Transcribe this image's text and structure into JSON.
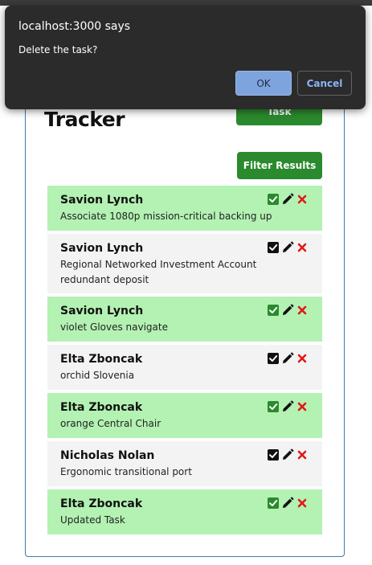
{
  "page": {
    "title": "Tracker",
    "add_button_label": "Task",
    "filter_button_label": "Filter Results"
  },
  "tasks": [
    {
      "name": "Savion Lynch",
      "description": "Associate 1080p mission-critical backing up",
      "completed": true
    },
    {
      "name": "Savion Lynch",
      "description": "Regional Networked Investment Account redundant deposit",
      "completed": false
    },
    {
      "name": "Savion Lynch",
      "description": "violet Gloves navigate",
      "completed": true
    },
    {
      "name": "Elta Zboncak",
      "description": "orchid Slovenia",
      "completed": false
    },
    {
      "name": "Elta Zboncak",
      "description": "orange Central Chair",
      "completed": true
    },
    {
      "name": "Nicholas Nolan",
      "description": "Ergonomic transitional port",
      "completed": false
    },
    {
      "name": "Elta Zboncak",
      "description": "Updated Task",
      "completed": true
    }
  ],
  "icons": {
    "check": "checkbox-icon",
    "edit": "pencil-icon",
    "delete": "x-icon"
  },
  "colors": {
    "done_bg": "#b3f2b2",
    "todo_bg": "#f3f3f3",
    "accent_green": "#2b8a2d",
    "delete_red": "#e0191b"
  },
  "dialog": {
    "title": "localhost:3000 says",
    "message": "Delete the task?",
    "ok_label": "OK",
    "cancel_label": "Cancel"
  }
}
